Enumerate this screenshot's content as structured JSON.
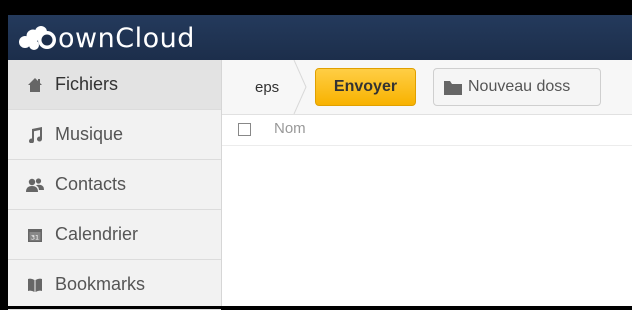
{
  "app": {
    "logo_text": "ownCloud"
  },
  "sidebar": {
    "items": [
      {
        "label": "Fichiers",
        "icon": "home-icon",
        "active": true
      },
      {
        "label": "Musique",
        "icon": "music-icon",
        "active": false
      },
      {
        "label": "Contacts",
        "icon": "users-icon",
        "active": false
      },
      {
        "label": "Calendrier",
        "icon": "calendar-icon",
        "active": false
      },
      {
        "label": "Bookmarks",
        "icon": "book-icon",
        "active": false
      }
    ]
  },
  "controls": {
    "breadcrumb": "eps",
    "upload_label": "Envoyer",
    "new_folder_label": "Nouveau doss"
  },
  "file_list": {
    "name_header": "Nom"
  },
  "colors": {
    "header": "#1c2e4b",
    "upload_button": "#f8b200",
    "sidebar": "#f2f2f2"
  }
}
